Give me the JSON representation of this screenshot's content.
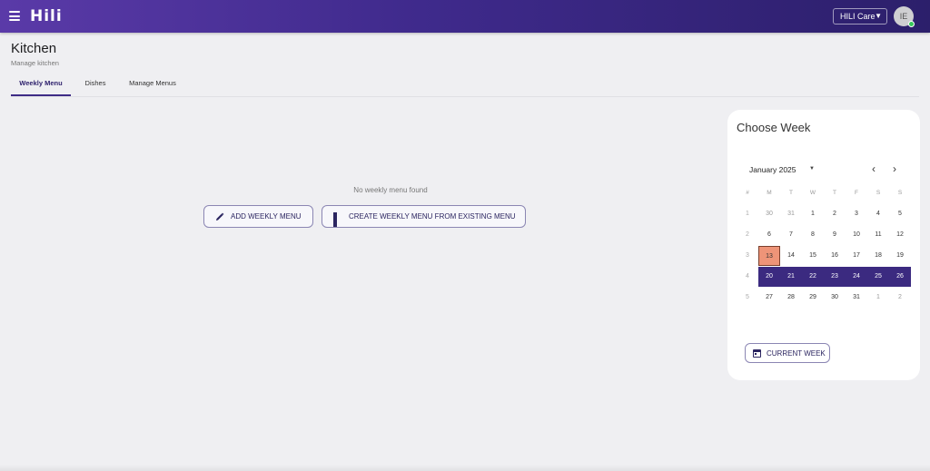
{
  "app": {
    "logo": "Hili",
    "org_select": "HILI Care",
    "user_initials": "IE",
    "colors": {
      "topbar_start": "#5a3aa8",
      "topbar_end": "#2c1f6b",
      "accent": "#3b2a80",
      "today": "#ee9478",
      "online": "#35c759"
    }
  },
  "header": {
    "title": "Kitchen",
    "subtitle": "Manage kitchen"
  },
  "tabs": [
    {
      "label": "Weekly Menu",
      "active": true
    },
    {
      "label": "Dishes",
      "active": false
    },
    {
      "label": "Manage Menus",
      "active": false
    }
  ],
  "empty_state": {
    "message": "No weekly menu found",
    "add_button": "ADD WEEKLY MENU",
    "create_button": "CREATE WEEKLY MENU FROM EXISTING MENU",
    "icons": {
      "add": "pencil-icon",
      "create": "dashboard-icon"
    }
  },
  "calendar": {
    "title": "Choose Week",
    "month_label": "January 2025",
    "headers": [
      "#",
      "M",
      "T",
      "W",
      "T",
      "F",
      "S",
      "S"
    ],
    "weeks": [
      {
        "week": "1",
        "days": [
          "30",
          "31",
          "1",
          "2",
          "3",
          "4",
          "5"
        ]
      },
      {
        "week": "2",
        "days": [
          "6",
          "7",
          "8",
          "9",
          "10",
          "11",
          "12"
        ]
      },
      {
        "week": "3",
        "days": [
          "13",
          "14",
          "15",
          "16",
          "17",
          "18",
          "19"
        ]
      },
      {
        "week": "4",
        "days": [
          "20",
          "21",
          "22",
          "23",
          "24",
          "25",
          "26"
        ]
      },
      {
        "week": "5",
        "days": [
          "27",
          "28",
          "29",
          "30",
          "31",
          "1",
          "2"
        ]
      }
    ],
    "selected_week": "4",
    "today": "13",
    "current_week_button": "CURRENT WEEK"
  }
}
